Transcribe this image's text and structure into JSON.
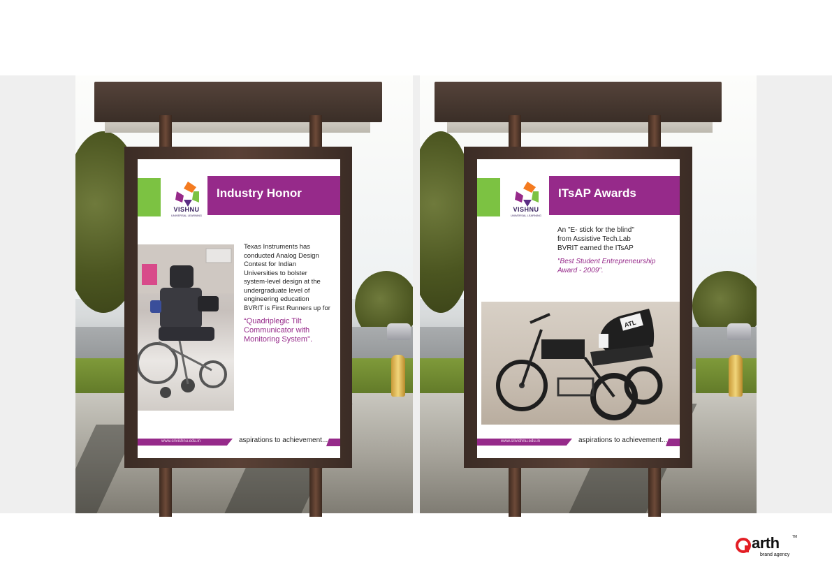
{
  "poster_left": {
    "title": "Industry Honor",
    "brand": "VISHNU",
    "brand_sub": "UNIVERSAL LEARNING",
    "body_lines": [
      "Texas Instruments has",
      "conducted Analog Design",
      "Contest for Indian",
      "Universities to bolster",
      "system-level design at the",
      "undergraduate level of",
      "engineering education",
      "BVRIT is First Runners up for"
    ],
    "quote_lines": [
      "“Quadriplegic Tilt",
      "Communicator with",
      "Monitoring System\"."
    ],
    "url": "www.srivishnu.edu.in",
    "tagline": "aspirations to achievement..."
  },
  "poster_right": {
    "title": "ITsAP Awards",
    "brand": "VISHNU",
    "brand_sub": "UNIVERSAL LEARNING",
    "body_lines": [
      "An \"E- stick for the blind\"",
      "from Assistive Tech.Lab",
      "BVRIT earned the ITsAP"
    ],
    "quote_lines": [
      "\"Best Student Entrepreneurship",
      "Award - 2009\"."
    ],
    "seat_label": "ATL",
    "url": "www.srivishnu.edu.in",
    "tagline": "aspirations to achievement..."
  },
  "agency": {
    "name": "arth",
    "tm": "TM",
    "sub": "brand agency"
  },
  "colors": {
    "purple": "#962a8a",
    "green": "#7cc242",
    "agency_red": "#e31e24"
  },
  "icons": [
    "vishnu-logo-icon",
    "arth-logo-icon"
  ]
}
